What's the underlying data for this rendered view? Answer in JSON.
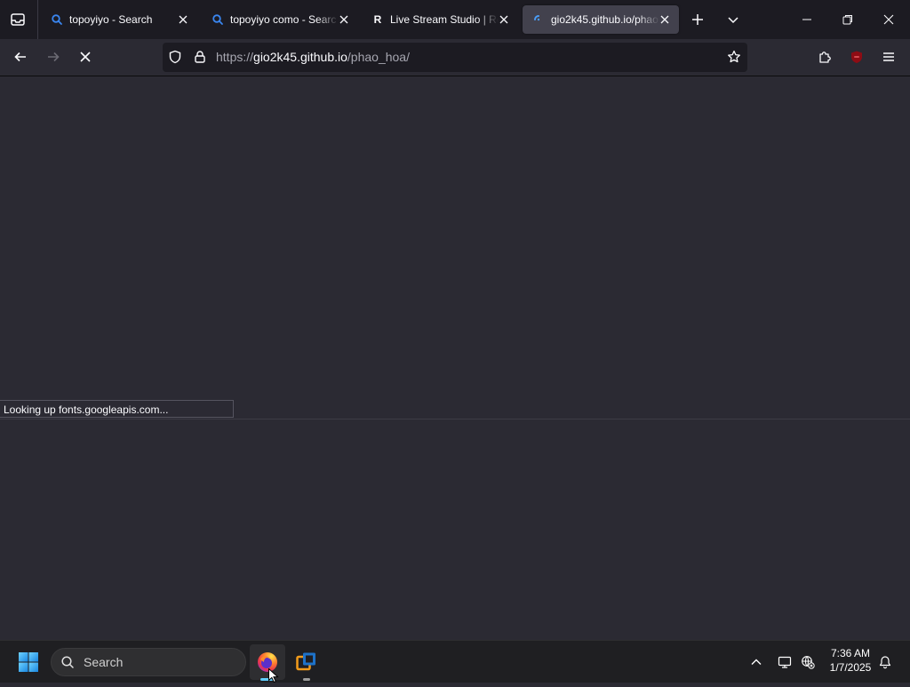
{
  "colors": {
    "tab_bar_bg": "#1c1b22",
    "toolbar_bg": "#2b2a33",
    "url_bar_bg": "#1c1b22",
    "active_tab_bg": "#42414d",
    "content_bg": "#2b2a33",
    "taskbar_bg": "#1f1f22",
    "accent": "#4a9df8"
  },
  "browser": {
    "tabs": [
      {
        "title": "topoyiyo - Search",
        "icon": "search-icon",
        "active": false
      },
      {
        "title": "topoyiyo como - Searc",
        "icon": "search-icon",
        "active": false
      },
      {
        "title": "Live Stream Studio | Re",
        "icon": "r-favicon",
        "favicon_text": "R",
        "active": false
      },
      {
        "title": "gio2k45.github.io/phao",
        "icon": "loading-icon",
        "active": true
      }
    ],
    "url": {
      "scheme": "https://",
      "host": "gio2k45.github.io",
      "path": "/phao_hoa/"
    },
    "status_text": "Looking up fonts.googleapis.com..."
  },
  "taskbar": {
    "search_label": "Search",
    "time": "7:36 AM",
    "date": "1/7/2025"
  }
}
